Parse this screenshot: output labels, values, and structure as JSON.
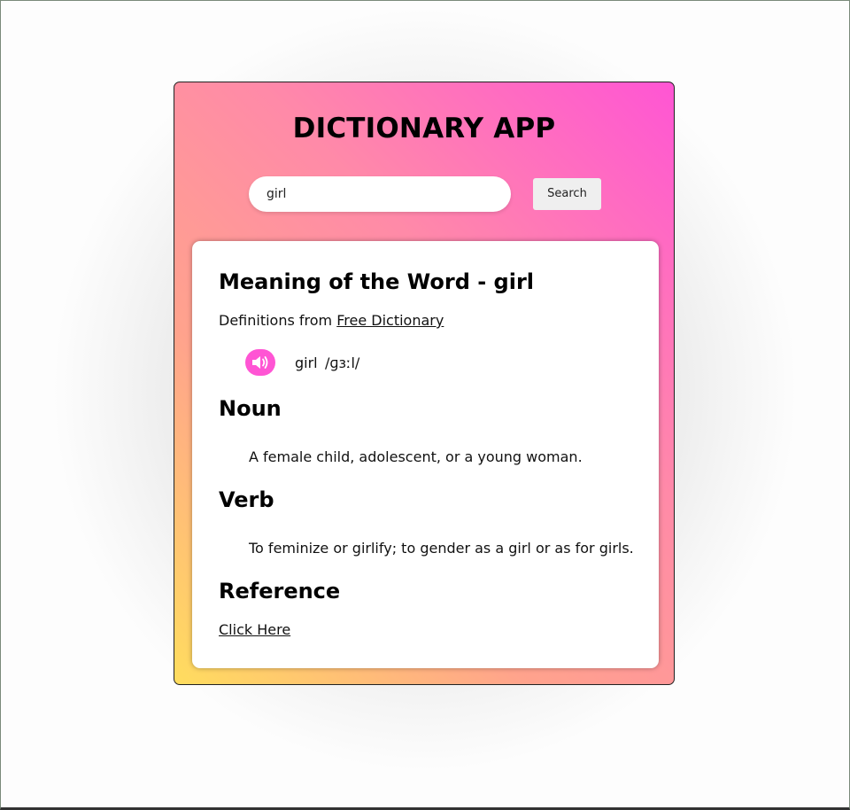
{
  "app": {
    "title": "DICTIONARY APP"
  },
  "search": {
    "value": "girl",
    "placeholder": "",
    "button_label": "Search"
  },
  "result": {
    "heading": "Meaning of the Word - girl",
    "source_prefix": "Definitions from",
    "source_link": "Free Dictionary",
    "audio_icon": "speaker-icon",
    "phonetic_word": "girl",
    "phonetic_text": "/ɡɜːl/",
    "meanings": [
      {
        "part_of_speech": "Noun",
        "definition": "A female child, adolescent, or a young woman."
      },
      {
        "part_of_speech": "Verb",
        "definition": "To feminize or girlify; to gender as a girl or as for girls."
      }
    ],
    "reference_heading": "Reference",
    "reference_link": "Click Here"
  },
  "colors": {
    "gradient_pink": "#ff55d4",
    "gradient_yellow": "#ffdd5e",
    "audio_button": "#ff55d4",
    "card_bg": "#ffffff"
  }
}
